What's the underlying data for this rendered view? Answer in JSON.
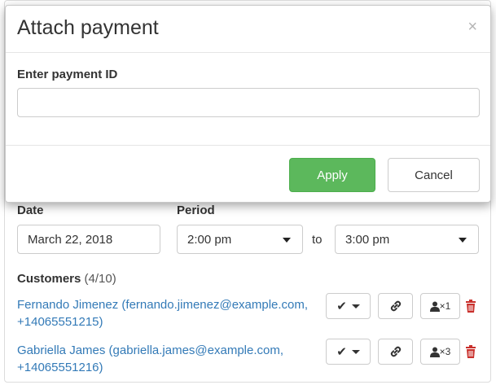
{
  "modal": {
    "title": "Attach payment",
    "close_symbol": "×",
    "field_label": "Enter payment ID",
    "field_value": "",
    "field_placeholder": "",
    "apply_label": "Apply",
    "cancel_label": "Cancel"
  },
  "form": {
    "date_label": "Date",
    "date_value": "March 22, 2018",
    "period_label": "Period",
    "period_from": "2:00 pm",
    "to_label": "to",
    "period_to": "3:00 pm"
  },
  "customers": {
    "title": "Customers",
    "count": "(4/10)",
    "items": [
      {
        "line1": "Fernando Jimenez (fernando.jimenez@example.com,",
        "line2": "+14065551215)",
        "check_symbol": "✔",
        "guest_badge": "×1"
      },
      {
        "line1": "Gabriella James (gabriella.james@example.com,",
        "line2": "+14065551216)",
        "check_symbol": "✔",
        "guest_badge": "×3"
      }
    ]
  },
  "colors": {
    "link": "#337ab7",
    "apply": "#5cb85c",
    "delete": "#c9302c"
  },
  "icons": [
    "close-icon",
    "caret-down-icon",
    "check-icon",
    "link-icon",
    "user-icon",
    "trash-icon"
  ]
}
